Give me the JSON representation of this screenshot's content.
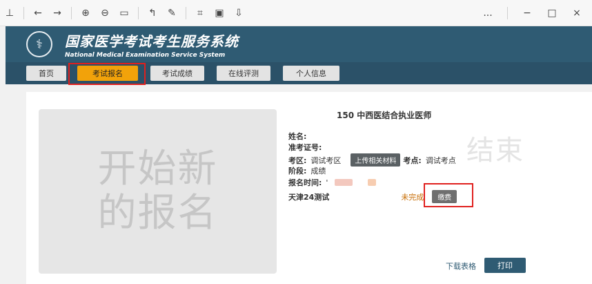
{
  "toolbar": {
    "icons": [
      "pin-icon",
      "back-icon",
      "forward-icon",
      "zoom-in-icon",
      "zoom-out-icon",
      "fit-icon",
      "rotate-icon",
      "edit-icon",
      "crop-icon",
      "screenshot-icon",
      "export-icon"
    ],
    "more_label": "...",
    "minimize_label": "−",
    "maximize_label": "□",
    "close_label": "×"
  },
  "header": {
    "title_cn": "国家医学考试考生服务系统",
    "title_en": "National Medical Examination Service System"
  },
  "nav": {
    "items": [
      {
        "label": "首页"
      },
      {
        "label": "考试报名"
      },
      {
        "label": "考试成绩"
      },
      {
        "label": "在线评测"
      },
      {
        "label": "个人信息"
      }
    ]
  },
  "new_registration": {
    "line1": "开始新",
    "line2": "的报名"
  },
  "exam": {
    "title": "150 中西医结合执业医师",
    "name_label": "姓名:",
    "ticket_label": "准考证号:",
    "area_label": "考区:",
    "area_value": "调试考区",
    "upload_label": "上传相关材料",
    "site_label": "考点:",
    "site_value": "调试考点",
    "stage_label": "阶段:",
    "stage_value": "成绩",
    "time_label": "报名时间:",
    "time_prefix": "'",
    "exam_name": "天津24测试",
    "status": "未完成",
    "pay_label": "缴费",
    "ended_label": "结束"
  },
  "footer": {
    "download_label": "下载表格",
    "print_label": "打印"
  }
}
